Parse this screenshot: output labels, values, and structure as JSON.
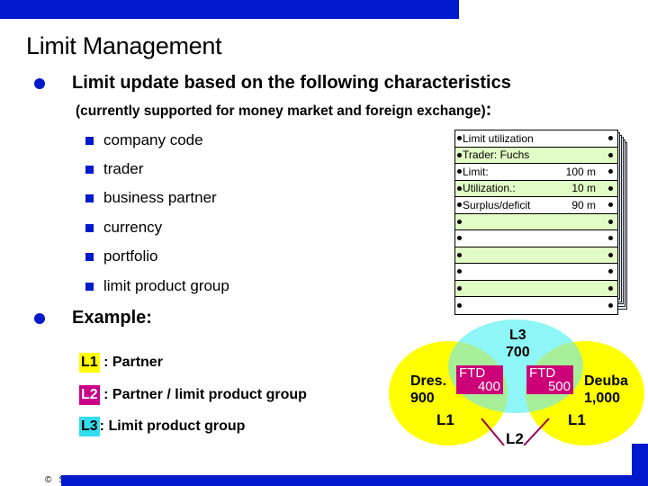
{
  "title": "Limit Management",
  "bullets": {
    "main_1": "Limit update based on the following characteristics",
    "main_1_note": "(currently supported for money market and foreign exchange)",
    "main_1_note_colon": ":",
    "characteristics": [
      "company code",
      "trader",
      "business partner",
      "currency",
      "portfolio",
      "limit product group"
    ],
    "main_2": "Example:"
  },
  "legend": [
    {
      "badge": "L1",
      "text": " : Partner",
      "color": "#ffff00"
    },
    {
      "badge": "L2",
      "text": " : Partner / limit product group",
      "color": "#cc0088"
    },
    {
      "badge": "L3",
      "text": ": Limit product group",
      "color": "#33ddf0"
    }
  ],
  "printout": {
    "rows": [
      {
        "label": "Limit utilization",
        "value": ""
      },
      {
        "label": "Trader: Fuchs",
        "value": ""
      },
      {
        "label": "Limit:",
        "value": "100 m"
      },
      {
        "label": "Utilization.:",
        "value": "10 m"
      },
      {
        "label": "Surplus/deficit",
        "value": "90 m"
      },
      {
        "label": "",
        "value": ""
      },
      {
        "label": "",
        "value": ""
      },
      {
        "label": "",
        "value": ""
      },
      {
        "label": "",
        "value": ""
      },
      {
        "label": "",
        "value": ""
      },
      {
        "label": "",
        "value": ""
      }
    ]
  },
  "venn": {
    "left": {
      "name": "Dres.",
      "amount": "900",
      "level": "L1"
    },
    "right": {
      "name": "Deuba",
      "amount": "1,000",
      "level": "L1"
    },
    "top": {
      "level": "L3",
      "amount": "700"
    },
    "ftd_left": {
      "label": "FTD",
      "amount": "400"
    },
    "ftd_right": {
      "label": "FTD",
      "amount": "500"
    },
    "bottom": {
      "level": "L2"
    }
  },
  "footer": {
    "copyright_symbol": "©",
    "company": "SAP AG"
  },
  "colors": {
    "brand_blue": "#0019cc",
    "l1_yellow": "#ffff00",
    "l2_magenta": "#cc0077",
    "l3_cyan": "#33ddf0",
    "green_row": "#e2fcc6"
  }
}
